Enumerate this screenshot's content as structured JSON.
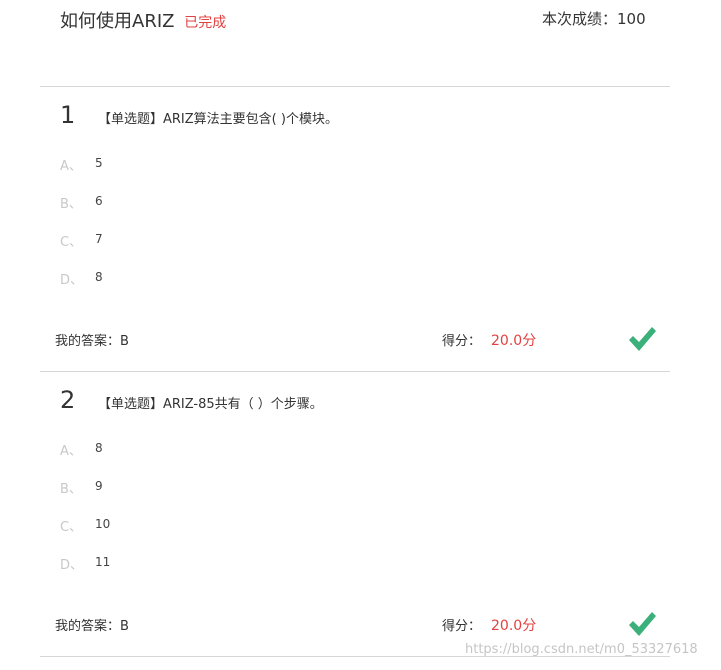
{
  "header": {
    "title": "如何使用ARIZ",
    "status": "已完成",
    "score_text": "本次成绩：100"
  },
  "questions": [
    {
      "number": "1",
      "text": "【单选题】ARIZ算法主要包含( )个模块。",
      "options": [
        {
          "letter": "A、",
          "text": "5"
        },
        {
          "letter": "B、",
          "text": "6"
        },
        {
          "letter": "C、",
          "text": "7"
        },
        {
          "letter": "D、",
          "text": "8"
        }
      ],
      "my_answer": "我的答案：B",
      "score_label": "得分：",
      "score_value": "20.0分",
      "result_icon": "checkmark-icon",
      "result_color": "#3bb07a"
    },
    {
      "number": "2",
      "text": "【单选题】ARIZ-85共有（ ）个步骤。",
      "options": [
        {
          "letter": "A、",
          "text": "8"
        },
        {
          "letter": "B、",
          "text": "9"
        },
        {
          "letter": "C、",
          "text": "10"
        },
        {
          "letter": "D、",
          "text": "11"
        }
      ],
      "my_answer": "我的答案：B",
      "score_label": "得分：",
      "score_value": "20.0分",
      "result_icon": "checkmark-icon",
      "result_color": "#3bb07a"
    }
  ],
  "watermark": "https://blog.csdn.net/m0_53327618",
  "colors": {
    "status_red": "#e34141",
    "correct_green": "#3bb07a",
    "divider": "#d6d6d6"
  }
}
